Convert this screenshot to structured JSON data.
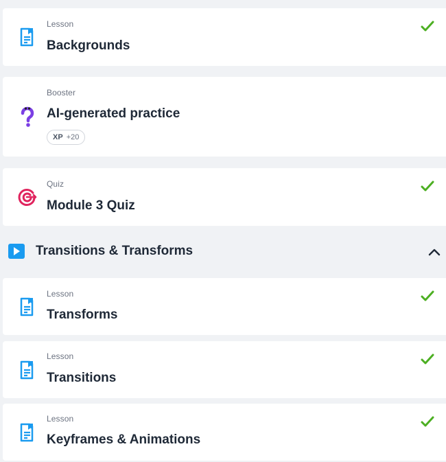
{
  "items_before": [
    {
      "type": "Lesson",
      "title": "Backgrounds",
      "icon": "lesson-doc-icon",
      "completed": true
    },
    {
      "type": "Booster",
      "title": "AI-generated practice",
      "icon": "question-mark-icon",
      "completed": false,
      "badge": {
        "label": "XP",
        "value": "+20"
      }
    },
    {
      "type": "Quiz",
      "title": "Module 3 Quiz",
      "icon": "target-icon",
      "completed": true
    }
  ],
  "section": {
    "title": "Transitions & Transforms",
    "icon": "play-icon",
    "expanded": true
  },
  "items_after": [
    {
      "type": "Lesson",
      "title": "Transforms",
      "icon": "lesson-doc-icon",
      "completed": true
    },
    {
      "type": "Lesson",
      "title": "Transitions",
      "icon": "lesson-doc-icon",
      "completed": true
    },
    {
      "type": "Lesson",
      "title": "Keyframes & Animations",
      "icon": "lesson-doc-icon",
      "completed": true
    }
  ],
  "colors": {
    "background": "#f0f2f5",
    "card": "#ffffff",
    "check": "#4caf22",
    "lesson_icon": "#1a9bf0",
    "quiz_icon": "#e0245e",
    "booster_icon": "#7b3fe4"
  }
}
